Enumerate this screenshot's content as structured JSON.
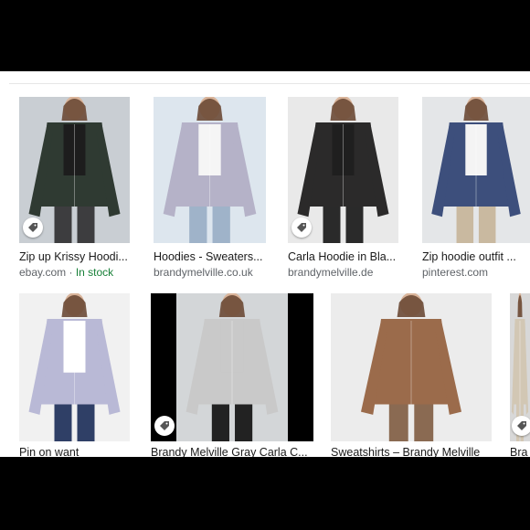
{
  "results_row1": [
    {
      "title": "Zip up Krissy Hoodi...",
      "source": "ebay.com",
      "stock_sep": " · ",
      "stock": "In stock",
      "icon": "tag-icon",
      "colors": {
        "bg": "#c9ced3",
        "jacket": "#2f3a32",
        "top": "#1d1d1d",
        "pants": "#3d3d3f"
      }
    },
    {
      "title": "Hoodies - Sweaters...",
      "source": "brandymelville.co.uk",
      "icon": "",
      "colors": {
        "bg": "#dde6ee",
        "jacket": "#b5b2c8",
        "top": "#f5f5f5",
        "pants": "#9fb3c9"
      }
    },
    {
      "title": "Carla Hoodie in Bla...",
      "source": "brandymelville.de",
      "icon": "tag-icon",
      "colors": {
        "bg": "#e9e9e9",
        "jacket": "#2b2a2a",
        "top": "#1f1f1f",
        "pants": "#2a2a2a"
      }
    },
    {
      "title": "Zip hoodie outfit ...",
      "source": "pinterest.com",
      "icon": "",
      "colors": {
        "bg": "#e4e6e8",
        "jacket": "#3d4f7c",
        "top": "#f4f4f4",
        "pants": "#c9b9a0"
      }
    }
  ],
  "results_row2": [
    {
      "title": "Pin on want",
      "icon": "",
      "colors": {
        "bg": "#f1f1f1",
        "jacket": "#b9b9d6",
        "top": "#ffffff",
        "pants": "#2f3f66"
      }
    },
    {
      "title": "Brandy Melville Gray Carla C...",
      "icon": "tag-icon",
      "colors": {
        "bg": "#d3d6d8",
        "jacket": "#c9c9c9",
        "top": "#c9c9c9",
        "pants": "#222222"
      }
    },
    {
      "title": "Sweatshirts – Brandy Melville",
      "icon": "",
      "colors": {
        "bg": "#ececec",
        "jacket": "#9b6b4b",
        "top": "#9b6b4b",
        "pants": "#8a6a52"
      }
    },
    {
      "title": "Bra",
      "icon": "tag-icon",
      "colors": {
        "bg": "#d8d8d8",
        "jacket": "#d2c7b4",
        "top": "#d2c7b4",
        "pants": "#d2c7b4"
      }
    }
  ]
}
